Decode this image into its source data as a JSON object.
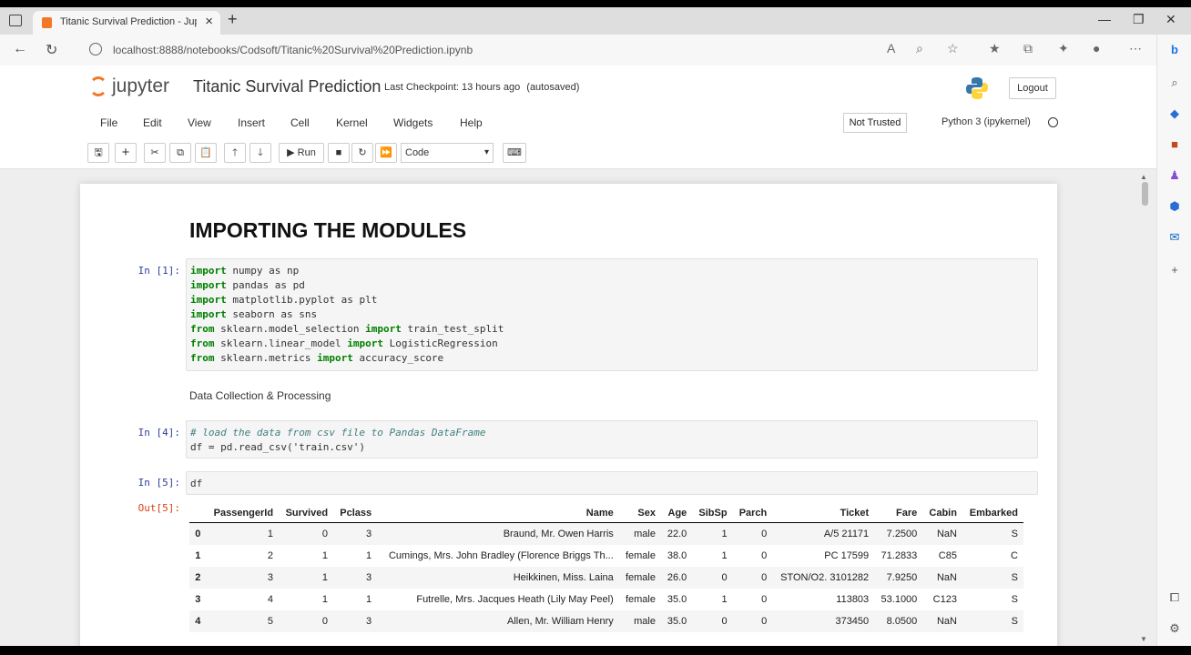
{
  "browser": {
    "tab_title": "Titanic Survival Prediction - Jupy",
    "url": "localhost:8888/notebooks/Codsoft/Titanic%20Survival%20Prediction.ipynb"
  },
  "jupyter": {
    "logo_text": "jupyter",
    "notebook_title": "Titanic Survival Prediction",
    "checkpoint": "Last Checkpoint: 13 hours ago",
    "autosave": "(autosaved)",
    "logout": "Logout",
    "menu": [
      "File",
      "Edit",
      "View",
      "Insert",
      "Cell",
      "Kernel",
      "Widgets",
      "Help"
    ],
    "trusted": "Not Trusted",
    "kernel": "Python 3 (ipykernel)",
    "run_label": "Run",
    "cell_type": "Code"
  },
  "cells": {
    "heading": "IMPORTING THE MODULES",
    "prompt1": "In [1]:",
    "code1": [
      {
        "kw": "import",
        "rest": " numpy as np"
      },
      {
        "kw": "import",
        "rest": " pandas as pd"
      },
      {
        "kw": "import",
        "rest": " matplotlib.pyplot as plt"
      },
      {
        "kw": "import",
        "rest": " seaborn as sns"
      },
      {
        "kw": "from",
        "rest": " sklearn.model_selection ",
        "kw2": "import",
        "rest2": " train_test_split"
      },
      {
        "kw": "from",
        "rest": " sklearn.linear_model ",
        "kw2": "import",
        "rest2": " LogisticRegression"
      },
      {
        "kw": "from",
        "rest": " sklearn.metrics ",
        "kw2": "import",
        "rest2": " accuracy_score"
      }
    ],
    "md_text": "Data Collection & Processing",
    "prompt4": "In [4]:",
    "code4_comment": "# load the data from csv file to Pandas DataFrame",
    "code4_line2": "df = pd.read_csv('train.csv')",
    "prompt5": "In [5]:",
    "code5": "df",
    "out5": "Out[5]:"
  },
  "dataframe": {
    "columns": [
      "",
      "PassengerId",
      "Survived",
      "Pclass",
      "Name",
      "Sex",
      "Age",
      "SibSp",
      "Parch",
      "Ticket",
      "Fare",
      "Cabin",
      "Embarked"
    ],
    "rows": [
      [
        "0",
        "1",
        "0",
        "3",
        "Braund, Mr. Owen Harris",
        "male",
        "22.0",
        "1",
        "0",
        "A/5 21171",
        "7.2500",
        "NaN",
        "S"
      ],
      [
        "1",
        "2",
        "1",
        "1",
        "Cumings, Mrs. John Bradley (Florence Briggs Th...",
        "female",
        "38.0",
        "1",
        "0",
        "PC 17599",
        "71.2833",
        "C85",
        "C"
      ],
      [
        "2",
        "3",
        "1",
        "3",
        "Heikkinen, Miss. Laina",
        "female",
        "26.0",
        "0",
        "0",
        "STON/O2. 3101282",
        "7.9250",
        "NaN",
        "S"
      ],
      [
        "3",
        "4",
        "1",
        "1",
        "Futrelle, Mrs. Jacques Heath (Lily May Peel)",
        "female",
        "35.0",
        "1",
        "0",
        "113803",
        "53.1000",
        "C123",
        "S"
      ],
      [
        "4",
        "5",
        "0",
        "3",
        "Allen, Mr. William Henry",
        "male",
        "35.0",
        "0",
        "0",
        "373450",
        "8.0500",
        "NaN",
        "S"
      ]
    ]
  }
}
